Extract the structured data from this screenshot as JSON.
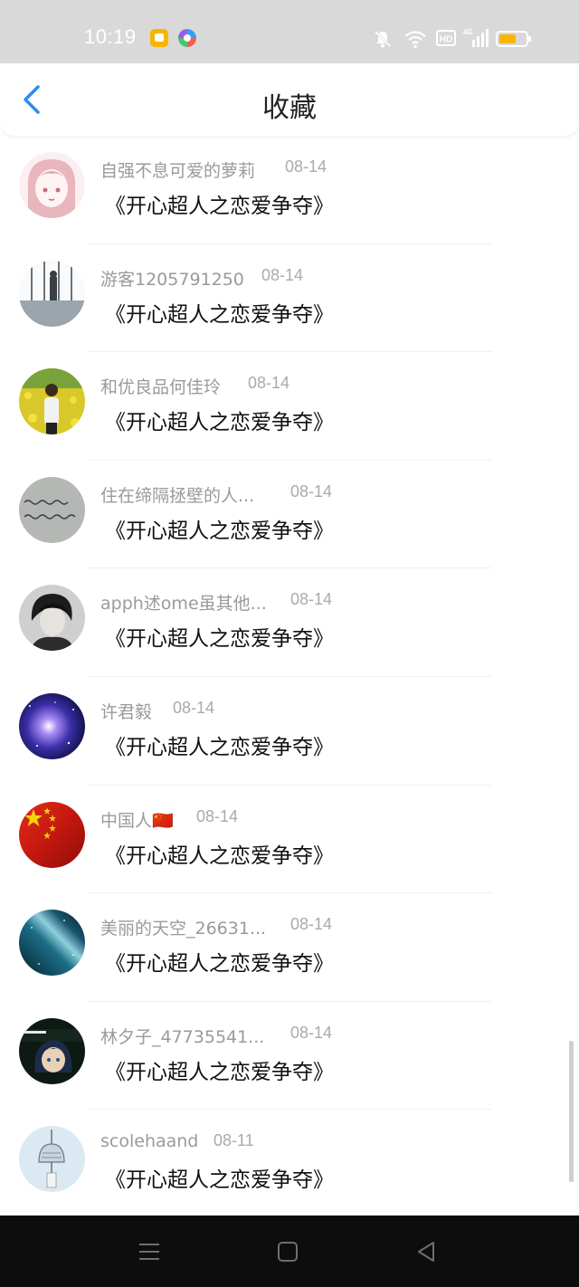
{
  "status_bar": {
    "time": "10:19",
    "icons": [
      "notification-app-icon",
      "photos-app-icon",
      "mute-icon",
      "wifi-icon",
      "hd-icon",
      "signal-4g-icon",
      "battery-icon"
    ],
    "colors": {
      "bg": "#d9d9d9",
      "battery": "#f7b500"
    }
  },
  "nav": {
    "title": "收藏",
    "back_icon": "chevron-left-icon",
    "accent": "#2a8bf2"
  },
  "items": [
    {
      "name": "自强不息可爱的萝莉",
      "date": "08-14",
      "title": "《开心超人之恋爱争夺》",
      "avatar": "anime-girl-avatar"
    },
    {
      "name": "游客1205791250",
      "date": "08-14",
      "title": "《开心超人之恋爱争夺》",
      "avatar": "window-man-avatar"
    },
    {
      "name": "和优良品何佳玲",
      "date": "08-14",
      "title": "《开心超人之恋爱争夺》",
      "avatar": "flower-field-avatar"
    },
    {
      "name": "住在缔隔拯壁的人...",
      "date": "08-14",
      "title": "《开心超人之恋爱争夺》",
      "avatar": "handwriting-avatar"
    },
    {
      "name": "apph述ome虽其他...",
      "date": "08-14",
      "title": "《开心超人之恋爱争夺》",
      "avatar": "portrait-avatar"
    },
    {
      "name": "许君毅",
      "date": "08-14",
      "title": "《开心超人之恋爱争夺》",
      "avatar": "galaxy-avatar"
    },
    {
      "name": "中国人🇨🇳",
      "date": "08-14",
      "title": "《开心超人之恋爱争夺》",
      "avatar": "flag-avatar"
    },
    {
      "name": "美丽的天空_26631...",
      "date": "08-14",
      "title": "《开心超人之恋爱争夺》",
      "avatar": "night-sky-avatar"
    },
    {
      "name": "林夕子_47735541...",
      "date": "08-14",
      "title": "《开心超人之恋爱争夺》",
      "avatar": "anime-boy-avatar"
    },
    {
      "name": "scolehaand",
      "date": "08-11",
      "title": "《开心超人之恋爱争夺》",
      "avatar": "wind-chime-avatar"
    }
  ],
  "system_nav": {
    "icons": [
      "menu-icon",
      "home-icon",
      "back-triangle-icon"
    ]
  }
}
